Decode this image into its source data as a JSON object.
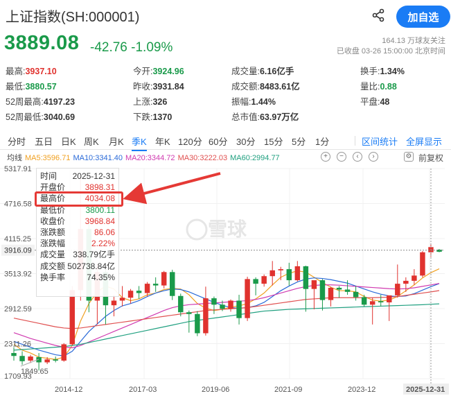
{
  "header": {
    "title": "上证指数(SH:000001)",
    "share_icon": "share-icon",
    "add_button": "加自选"
  },
  "quote": {
    "price": "3889.08",
    "change": "-42.76 -1.09%",
    "followers": "164.13 万球友关注",
    "status": "已收盘 03-26 15:00:00 北京时间"
  },
  "stats": [
    {
      "label": "最高:",
      "value": "3937.10",
      "color": "red"
    },
    {
      "label": "今开:",
      "value": "3924.96",
      "color": "green"
    },
    {
      "label": "成交量:",
      "value": "6.16亿手",
      "color": ""
    },
    {
      "label": "换手:",
      "value": "1.34%",
      "color": ""
    },
    {
      "label": "最低:",
      "value": "3880.57",
      "color": "green"
    },
    {
      "label": "昨收:",
      "value": "3931.84",
      "color": ""
    },
    {
      "label": "成交额:",
      "value": "8483.61亿",
      "color": ""
    },
    {
      "label": "量比:",
      "value": "0.88",
      "color": "green"
    },
    {
      "label": "52周最高:",
      "value": "4197.23",
      "color": ""
    },
    {
      "label": "上涨:",
      "value": "326",
      "color": ""
    },
    {
      "label": "振幅:",
      "value": "1.44%",
      "color": ""
    },
    {
      "label": "平盘:",
      "value": "48",
      "color": ""
    },
    {
      "label": "52周最低:",
      "value": "3040.69",
      "color": ""
    },
    {
      "label": "下跌:",
      "value": "1370",
      "color": ""
    },
    {
      "label": "总市值:",
      "value": "63.97万亿",
      "color": ""
    }
  ],
  "tabs": [
    "分时",
    "五日",
    "日K",
    "周K",
    "月K",
    "季K",
    "年K",
    "120分",
    "60分",
    "30分",
    "15分",
    "5分",
    "1分"
  ],
  "active_tab": "季K",
  "tab_right": [
    "区间统计",
    "全屏显示"
  ],
  "ma": {
    "label": "均线",
    "items": [
      {
        "text": "MA5:3596.71",
        "color": "#f0a020"
      },
      {
        "text": "MA10:3341.40",
        "color": "#2a6ad8"
      },
      {
        "text": "MA20:3344.72",
        "color": "#d03ab0"
      },
      {
        "text": "MA30:3222.03",
        "color": "#e05050"
      },
      {
        "text": "MA60:2994.77",
        "color": "#20a080"
      }
    ]
  },
  "tools": {
    "zoom_in_icon": "zoom-in-icon",
    "zoom_out_icon": "zoom-out-icon",
    "left_icon": "left-arrow-icon",
    "right_icon": "right-arrow-icon",
    "settings_icon": "settings-icon",
    "adjust": "前复权"
  },
  "tooltip": [
    {
      "k": "时间",
      "v": "2025-12-31",
      "color": ""
    },
    {
      "k": "开盘价",
      "v": "3898.31",
      "color": "red"
    },
    {
      "k": "最高价",
      "v": "4034.08",
      "color": "red"
    },
    {
      "k": "最低价",
      "v": "3800.11",
      "color": "green"
    },
    {
      "k": "收盘价",
      "v": "3968.84",
      "color": "red"
    },
    {
      "k": "涨跌额",
      "v": "86.06",
      "color": "red"
    },
    {
      "k": "涨跌幅",
      "v": "2.22%",
      "color": "red"
    },
    {
      "k": "成交量",
      "v": "338.79亿手",
      "color": ""
    },
    {
      "k": "成交额",
      "v": "502738.84亿",
      "color": ""
    },
    {
      "k": "换手率",
      "v": "74.35%",
      "color": ""
    }
  ],
  "watermark": "雪球",
  "colors": {
    "up": "#e0322e",
    "down": "#1a9a4a",
    "accent": "#1a7cf5"
  },
  "chart_data": {
    "type": "candlestick",
    "y_ticks": [
      "5317.91",
      "4716.58",
      "4115.25",
      "3513.92",
      "2912.59",
      "2311.26",
      "1709.93"
    ],
    "x_ticks": [
      "2014-12",
      "2017-03",
      "2019-06",
      "2021-09",
      "2023-12",
      "2025-12-31"
    ],
    "ylim": [
      1709.93,
      5317.91
    ],
    "current_price_label": "3916.09",
    "annotations": [
      "1849.65"
    ],
    "candles": [
      {
        "o": 2150,
        "h": 2250,
        "l": 2020,
        "c": 2100
      },
      {
        "o": 2100,
        "h": 2180,
        "l": 1950,
        "c": 2010
      },
      {
        "o": 2020,
        "h": 2120,
        "l": 1980,
        "c": 2090
      },
      {
        "o": 2080,
        "h": 2150,
        "l": 1849.65,
        "c": 1990
      },
      {
        "o": 1990,
        "h": 2080,
        "l": 1960,
        "c": 2040
      },
      {
        "o": 2040,
        "h": 2090,
        "l": 1990,
        "c": 2020
      },
      {
        "o": 2020,
        "h": 2320,
        "l": 2000,
        "c": 2300
      },
      {
        "o": 2300,
        "h": 3300,
        "l": 2280,
        "c": 3230
      },
      {
        "o": 3230,
        "h": 5178,
        "l": 3050,
        "c": 4280
      },
      {
        "o": 4280,
        "h": 4400,
        "l": 2850,
        "c": 3050
      },
      {
        "o": 3050,
        "h": 3680,
        "l": 2640,
        "c": 3540
      },
      {
        "o": 3540,
        "h": 3600,
        "l": 2640,
        "c": 2970
      },
      {
        "o": 2970,
        "h": 3150,
        "l": 2780,
        "c": 3050
      },
      {
        "o": 3050,
        "h": 3300,
        "l": 2950,
        "c": 3100
      },
      {
        "o": 3100,
        "h": 3250,
        "l": 3000,
        "c": 3220
      },
      {
        "o": 3220,
        "h": 3300,
        "l": 3080,
        "c": 3180
      },
      {
        "o": 3180,
        "h": 3370,
        "l": 3120,
        "c": 3340
      },
      {
        "o": 3340,
        "h": 3450,
        "l": 3200,
        "c": 3310
      },
      {
        "o": 3310,
        "h": 3560,
        "l": 3260,
        "c": 3540
      },
      {
        "o": 3540,
        "h": 3580,
        "l": 3060,
        "c": 3130
      },
      {
        "o": 3130,
        "h": 3170,
        "l": 2780,
        "c": 2850
      },
      {
        "o": 2850,
        "h": 2880,
        "l": 2500,
        "c": 2820
      },
      {
        "o": 2820,
        "h": 2870,
        "l": 2440,
        "c": 2490
      },
      {
        "o": 2490,
        "h": 3290,
        "l": 2450,
        "c": 3090
      },
      {
        "o": 3090,
        "h": 3120,
        "l": 2820,
        "c": 2980
      },
      {
        "o": 2980,
        "h": 3050,
        "l": 2870,
        "c": 2910
      },
      {
        "o": 2910,
        "h": 3070,
        "l": 2860,
        "c": 3050
      },
      {
        "o": 3050,
        "h": 3150,
        "l": 2640,
        "c": 2750
      },
      {
        "o": 2750,
        "h": 3460,
        "l": 2700,
        "c": 3420
      },
      {
        "o": 3420,
        "h": 3450,
        "l": 3140,
        "c": 3340
      },
      {
        "o": 3340,
        "h": 3500,
        "l": 3290,
        "c": 3470
      },
      {
        "o": 3470,
        "h": 3730,
        "l": 3310,
        "c": 3570
      },
      {
        "o": 3570,
        "h": 3630,
        "l": 3400,
        "c": 3590
      },
      {
        "o": 3590,
        "h": 3700,
        "l": 3310,
        "c": 3400
      },
      {
        "o": 3400,
        "h": 3730,
        "l": 3380,
        "c": 3640
      },
      {
        "o": 3640,
        "h": 3650,
        "l": 2860,
        "c": 3250
      },
      {
        "o": 3250,
        "h": 3340,
        "l": 2900,
        "c": 3400
      },
      {
        "o": 3400,
        "h": 3420,
        "l": 2880,
        "c": 3060
      },
      {
        "o": 3060,
        "h": 3290,
        "l": 2950,
        "c": 3270
      },
      {
        "o": 3270,
        "h": 3300,
        "l": 3100,
        "c": 3240
      },
      {
        "o": 3240,
        "h": 3400,
        "l": 3150,
        "c": 3200
      },
      {
        "o": 3200,
        "h": 3300,
        "l": 3050,
        "c": 3110
      },
      {
        "o": 3110,
        "h": 3150,
        "l": 2950,
        "c": 2980
      },
      {
        "o": 2980,
        "h": 3100,
        "l": 2640,
        "c": 3040
      },
      {
        "o": 3040,
        "h": 3150,
        "l": 2950,
        "c": 3020
      },
      {
        "o": 3020,
        "h": 3100,
        "l": 2700,
        "c": 3140
      },
      {
        "o": 3140,
        "h": 3670,
        "l": 3100,
        "c": 3340
      },
      {
        "o": 3340,
        "h": 3450,
        "l": 3200,
        "c": 3390
      },
      {
        "o": 3390,
        "h": 3590,
        "l": 3320,
        "c": 3480
      },
      {
        "o": 3480,
        "h": 3900,
        "l": 3450,
        "c": 3880
      },
      {
        "o": 3880,
        "h": 4034.08,
        "l": 3800.11,
        "c": 3968.84
      },
      {
        "o": 3924.96,
        "h": 3937.1,
        "l": 3880.57,
        "c": 3889.08
      }
    ],
    "ma_lines": [
      {
        "name": "MA5",
        "color": "#f0a020",
        "values": [
          2300,
          2200,
          2150,
          2080,
          2060,
          2040,
          2080,
          2280,
          2700,
          3000,
          3200,
          3300,
          3250,
          3100,
          3050,
          3080,
          3150,
          3180,
          3240,
          3260,
          3250,
          3150,
          3000,
          2920,
          2880,
          2900,
          2940,
          2960,
          3000,
          3080,
          3180,
          3320,
          3450,
          3520,
          3560,
          3540,
          3450,
          3360,
          3280,
          3220,
          3220,
          3200,
          3120,
          3060,
          3040,
          3060,
          3120,
          3220,
          3320,
          3440,
          3530,
          3596.71
        ]
      },
      {
        "name": "MA10",
        "color": "#2a6ad8",
        "values": [
          2350,
          2300,
          2250,
          2200,
          2160,
          2120,
          2100,
          2180,
          2350,
          2520,
          2650,
          2780,
          2880,
          2960,
          3000,
          3050,
          3120,
          3180,
          3220,
          3250,
          3240,
          3200,
          3140,
          3080,
          3020,
          2970,
          2930,
          2920,
          2930,
          2960,
          3020,
          3120,
          3220,
          3300,
          3370,
          3420,
          3440,
          3430,
          3410,
          3380,
          3350,
          3300,
          3250,
          3200,
          3160,
          3130,
          3120,
          3130,
          3170,
          3230,
          3290,
          3341.4
        ]
      },
      {
        "name": "MA20",
        "color": "#d03ab0",
        "values": [
          2500,
          2450,
          2400,
          2360,
          2320,
          2280,
          2250,
          2240,
          2280,
          2340,
          2400,
          2460,
          2520,
          2580,
          2640,
          2700,
          2760,
          2820,
          2880,
          2930,
          2960,
          2980,
          2990,
          3000,
          3010,
          3020,
          3030,
          3040,
          3050,
          3070,
          3100,
          3140,
          3180,
          3220,
          3260,
          3290,
          3310,
          3320,
          3320,
          3315,
          3305,
          3295,
          3285,
          3275,
          3265,
          3255,
          3250,
          3255,
          3270,
          3295,
          3320,
          3344.72
        ]
      },
      {
        "name": "MA30",
        "color": "#e05050",
        "values": [
          2750,
          2720,
          2690,
          2660,
          2630,
          2600,
          2580,
          2570,
          2580,
          2600,
          2620,
          2640,
          2660,
          2680,
          2700,
          2720,
          2740,
          2760,
          2780,
          2800,
          2820,
          2840,
          2860,
          2880,
          2890,
          2900,
          2910,
          2920,
          2930,
          2950,
          2970,
          2990,
          3010,
          3030,
          3050,
          3070,
          3080,
          3090,
          3100,
          3100,
          3100,
          3100,
          3100,
          3100,
          3105,
          3110,
          3120,
          3140,
          3160,
          3180,
          3200,
          3222.03
        ]
      },
      {
        "name": "MA60",
        "color": "#20a080",
        "values": [
          2200,
          2210,
          2220,
          2230,
          2240,
          2250,
          2260,
          2280,
          2300,
          2330,
          2360,
          2390,
          2420,
          2450,
          2480,
          2510,
          2540,
          2570,
          2600,
          2630,
          2660,
          2690,
          2710,
          2730,
          2750,
          2770,
          2790,
          2810,
          2830,
          2850,
          2870,
          2880,
          2890,
          2900,
          2905,
          2910,
          2915,
          2920,
          2925,
          2930,
          2935,
          2940,
          2945,
          2950,
          2955,
          2960,
          2965,
          2970,
          2975,
          2980,
          2988,
          2994.77
        ]
      }
    ]
  }
}
